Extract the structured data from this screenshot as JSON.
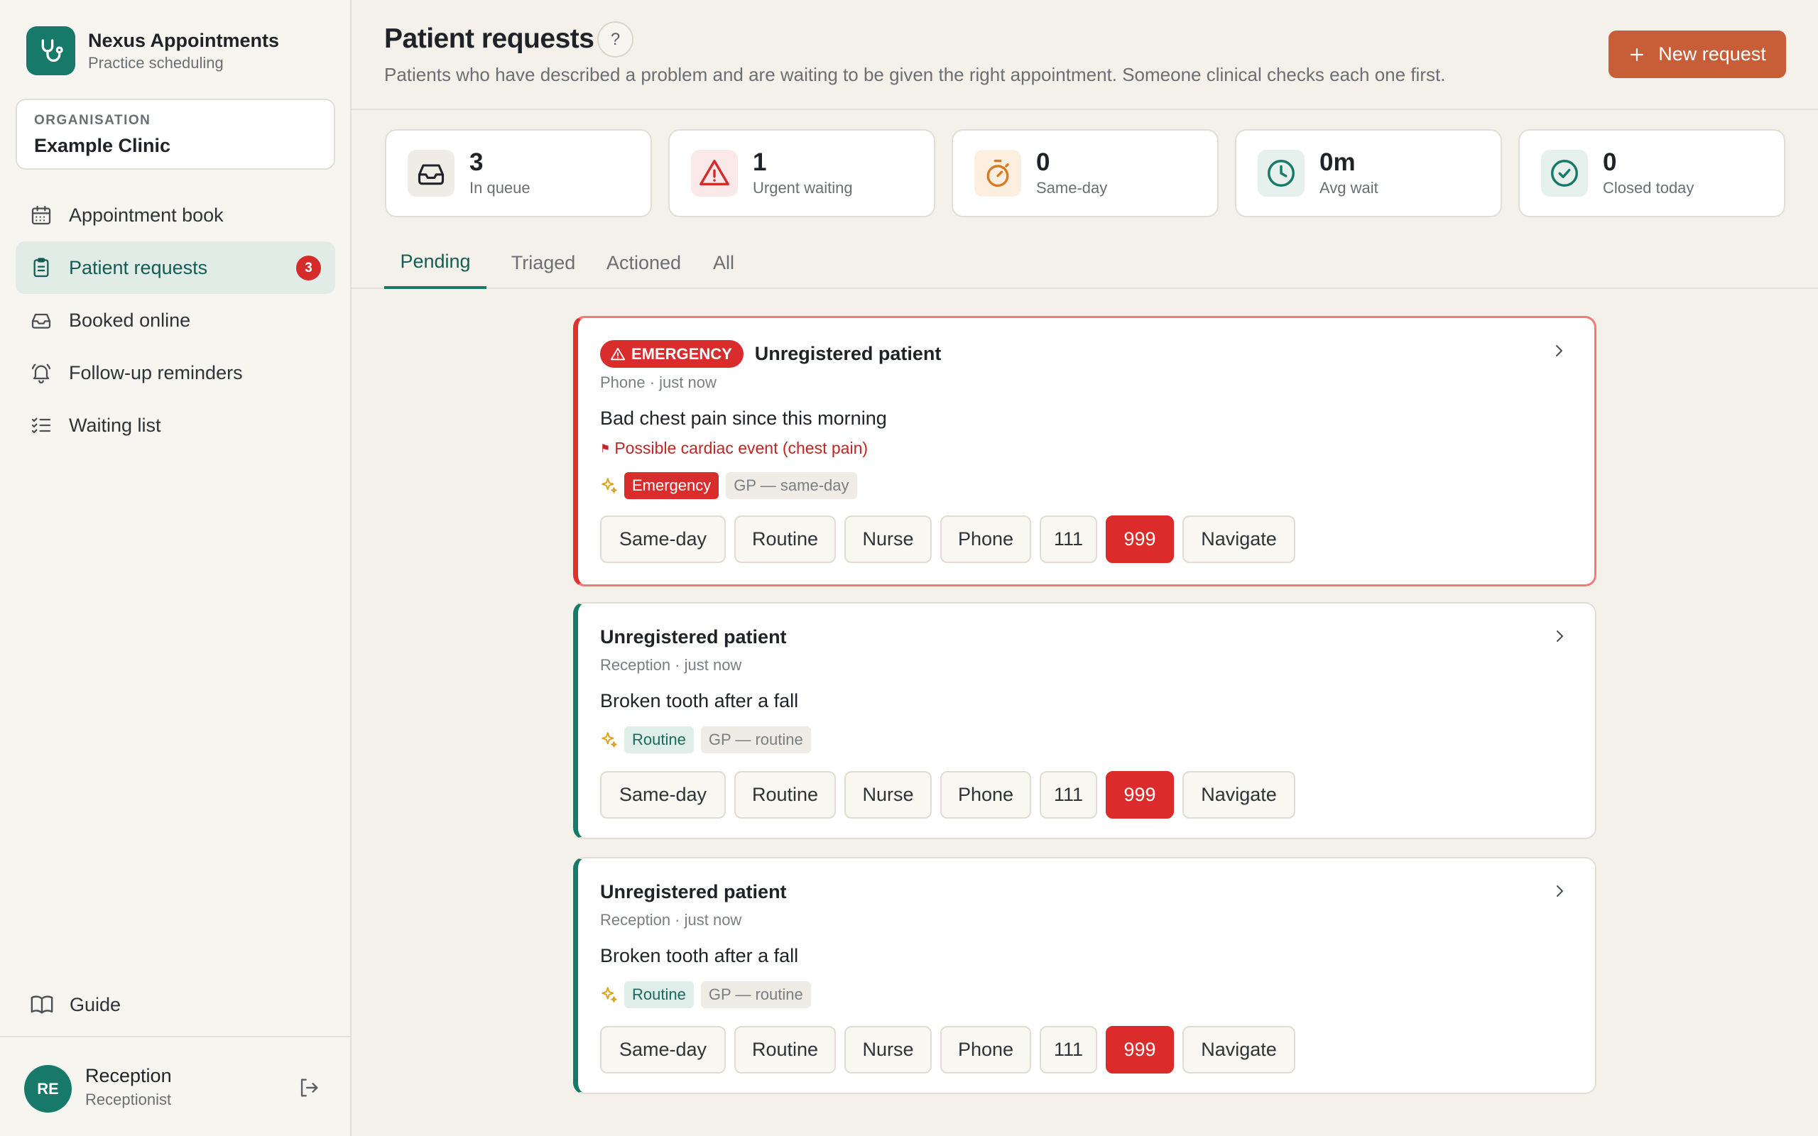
{
  "app": {
    "name": "Nexus Appointments",
    "subtitle": "Practice scheduling"
  },
  "organisation": {
    "label": "ORGANISATION",
    "name": "Example Clinic"
  },
  "sidebar": {
    "items": [
      {
        "label": "Appointment book",
        "icon": "calendar-icon"
      },
      {
        "label": "Patient requests",
        "icon": "clipboard-icon",
        "active": true,
        "badge": "3"
      },
      {
        "label": "Booked online",
        "icon": "inbox-icon"
      },
      {
        "label": "Follow-up reminders",
        "icon": "bell-icon"
      },
      {
        "label": "Waiting list",
        "icon": "list-check-icon"
      }
    ],
    "guide": "Guide"
  },
  "user": {
    "initials": "RE",
    "name": "Reception",
    "role": "Receptionist"
  },
  "header": {
    "title": "Patient requests",
    "help": "?",
    "subtitle": "Patients who have described a problem and are waiting to be given the right appointment. Someone clinical checks each one first.",
    "new_button": "New request",
    "new_button_plus": "+"
  },
  "stats": [
    {
      "value": "3",
      "label": "In queue",
      "icon": "inbox-icon"
    },
    {
      "value": "1",
      "label": "Urgent waiting",
      "icon": "warning-icon"
    },
    {
      "value": "0",
      "label": "Same-day",
      "icon": "stopwatch-icon"
    },
    {
      "value": "0m",
      "label": "Avg wait",
      "icon": "clock-icon"
    },
    {
      "value": "0",
      "label": "Closed today",
      "icon": "check-circle-icon"
    }
  ],
  "tabs": [
    "Pending",
    "Triaged",
    "Actioned",
    "All"
  ],
  "active_tab": "Pending",
  "requests": [
    {
      "badge": "EMERGENCY",
      "name": "Unregistered patient",
      "meta": "Phone · just now",
      "description": "Bad chest pain since this morning",
      "flag": "Possible cardiac event (chest pain)",
      "tag": "Emergency",
      "suggestion": "GP — same-day"
    },
    {
      "name": "Unregistered patient",
      "meta": "Reception · just now",
      "description": "Broken tooth after a fall",
      "tag": "Routine",
      "suggestion": "GP — routine"
    },
    {
      "name": "Unregistered patient",
      "meta": "Reception · just now",
      "description": "Broken tooth after a fall",
      "tag": "Routine",
      "suggestion": "GP — routine"
    }
  ],
  "actions": [
    "Same-day",
    "Routine",
    "Nurse",
    "Phone",
    "111",
    "999",
    "Navigate"
  ],
  "colors": {
    "brand": "#17796a",
    "accent": "#c85e38",
    "danger": "#d92d2d"
  }
}
